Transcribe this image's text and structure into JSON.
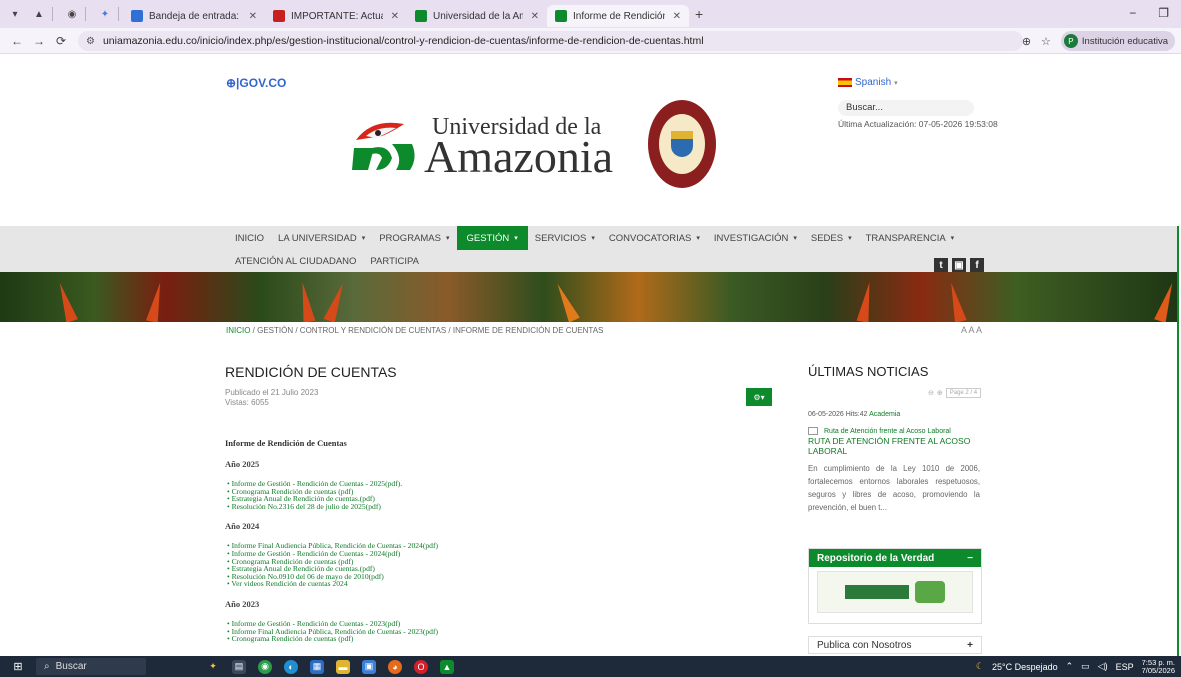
{
  "browser": {
    "tabs": [
      {
        "label": "Bandeja de entrada: PATRICIA I",
        "favicon_color": "#2f6fd6"
      },
      {
        "label": "IMPORTANTE: Actualización Mi",
        "favicon_color": "#c5221f"
      },
      {
        "label": "Universidad de la Amazonia",
        "favicon_color": "#0d8a2c"
      },
      {
        "label": "Informe de Rendición de cuent",
        "favicon_color": "#0d8a2c",
        "active": true
      }
    ],
    "url": "uniamazonia.edu.co/inicio/index.php/es/gestion-institucional/control-y-rendicion-de-cuentas/informe-de-rendicion-de-cuentas.html",
    "profile_label": "Institución educativa",
    "profile_initial": "P"
  },
  "header": {
    "govco": "⊕|GOV.CO",
    "language": "Spanish",
    "search_placeholder": "Buscar...",
    "last_update": "Última Actualización: 07-05-2026 19:53:08",
    "logo_line1": "Universidad de la",
    "logo_line2": "Amazonia"
  },
  "nav": {
    "row1": [
      {
        "label": "INICIO",
        "dropdown": false
      },
      {
        "label": "LA UNIVERSIDAD",
        "dropdown": true
      },
      {
        "label": "PROGRAMAS",
        "dropdown": true
      },
      {
        "label": "GESTIÓN",
        "dropdown": true,
        "active": true
      },
      {
        "label": "SERVICIOS",
        "dropdown": true
      },
      {
        "label": "CONVOCATORIAS",
        "dropdown": true
      },
      {
        "label": "INVESTIGACIÓN",
        "dropdown": true
      },
      {
        "label": "SEDES",
        "dropdown": true
      },
      {
        "label": "TRANSPARENCIA",
        "dropdown": true
      }
    ],
    "row2": [
      {
        "label": "ATENCIÓN AL CIUDADANO"
      },
      {
        "label": "PARTICIPA"
      }
    ],
    "social": [
      "t",
      "▣",
      "f"
    ]
  },
  "breadcrumb": {
    "home": "INICIO",
    "rest": " / GESTIÓN / CONTROL Y RENDICIÓN DE CUENTAS / INFORME DE RENDICIÓN DE CUENTAS",
    "text_size": "A A A"
  },
  "article": {
    "title": "RENDICIÓN DE CUENTAS",
    "published": "Publicado el 21 Julio 2023",
    "views": "Vistas: 6055",
    "heading": "Informe de Rendición de Cuentas",
    "years": [
      {
        "year": "Año 2025",
        "items": [
          "Informe de Gestión - Rendición de Cuentas - 2025(pdf).",
          "Cronograma Rendición de cuentas (pdf)",
          "Estrategia Anual de Rendición de cuentas.(pdf)",
          "Resolución No.2316 del 28 de julio de 2025(pdf)"
        ]
      },
      {
        "year": "Año 2024",
        "items": [
          "Informe Final Audiencia Pública, Rendición de Cuentas - 2024(pdf)",
          "Informe de Gestión - Rendición de Cuentas - 2024(pdf)",
          "Cronograma Rendición de cuentas (pdf)",
          "Estrategia Anual de Rendición de cuentas.(pdf)",
          "Resolución No.0910 del 06 de mayo de 2010(pdf)",
          "Ver videos Rendición de cuentas 2024"
        ]
      },
      {
        "year": "Año 2023",
        "items": [
          "Informe de Gestión - Rendición de Cuentas - 2023(pdf)",
          "Informe Final Audiencia Pública, Rendición de Cuentas - 2023(pdf)",
          "Cronograma Rendición de cuentas (pdf)"
        ]
      }
    ]
  },
  "sidebar": {
    "news_title": "ÚLTIMAS NOTICIAS",
    "pager": "Page 2 / 4",
    "news_date": "06-05-2026 Hits:42 ",
    "news_category": "Academia",
    "news_image_alt": "Ruta de Atención frente al Acoso Laboral",
    "news_headline": "RUTA DE ATENCIÓN FRENTE AL ACOSO LABORAL",
    "news_text": "En cumplimiento de la Ley 1010 de 2006, fortalecemos entornos laborales respetuosos, seguros y libres de acoso, promoviendo la prevención, el buen t...",
    "repo_title": "Repositorio de la Verdad",
    "repo_toggle": "−",
    "publica_title": "Publica con Nosotros",
    "publica_toggle": "+"
  },
  "taskbar": {
    "search_label": "Buscar",
    "weather": "25°C  Despejado",
    "lang": "ESP",
    "time": "7:53 p. m.",
    "date": "7/05/2026"
  },
  "colors": {
    "brand_green": "#0d8a2c",
    "link_green": "#0d7a26",
    "govco_blue": "#3366cc"
  }
}
